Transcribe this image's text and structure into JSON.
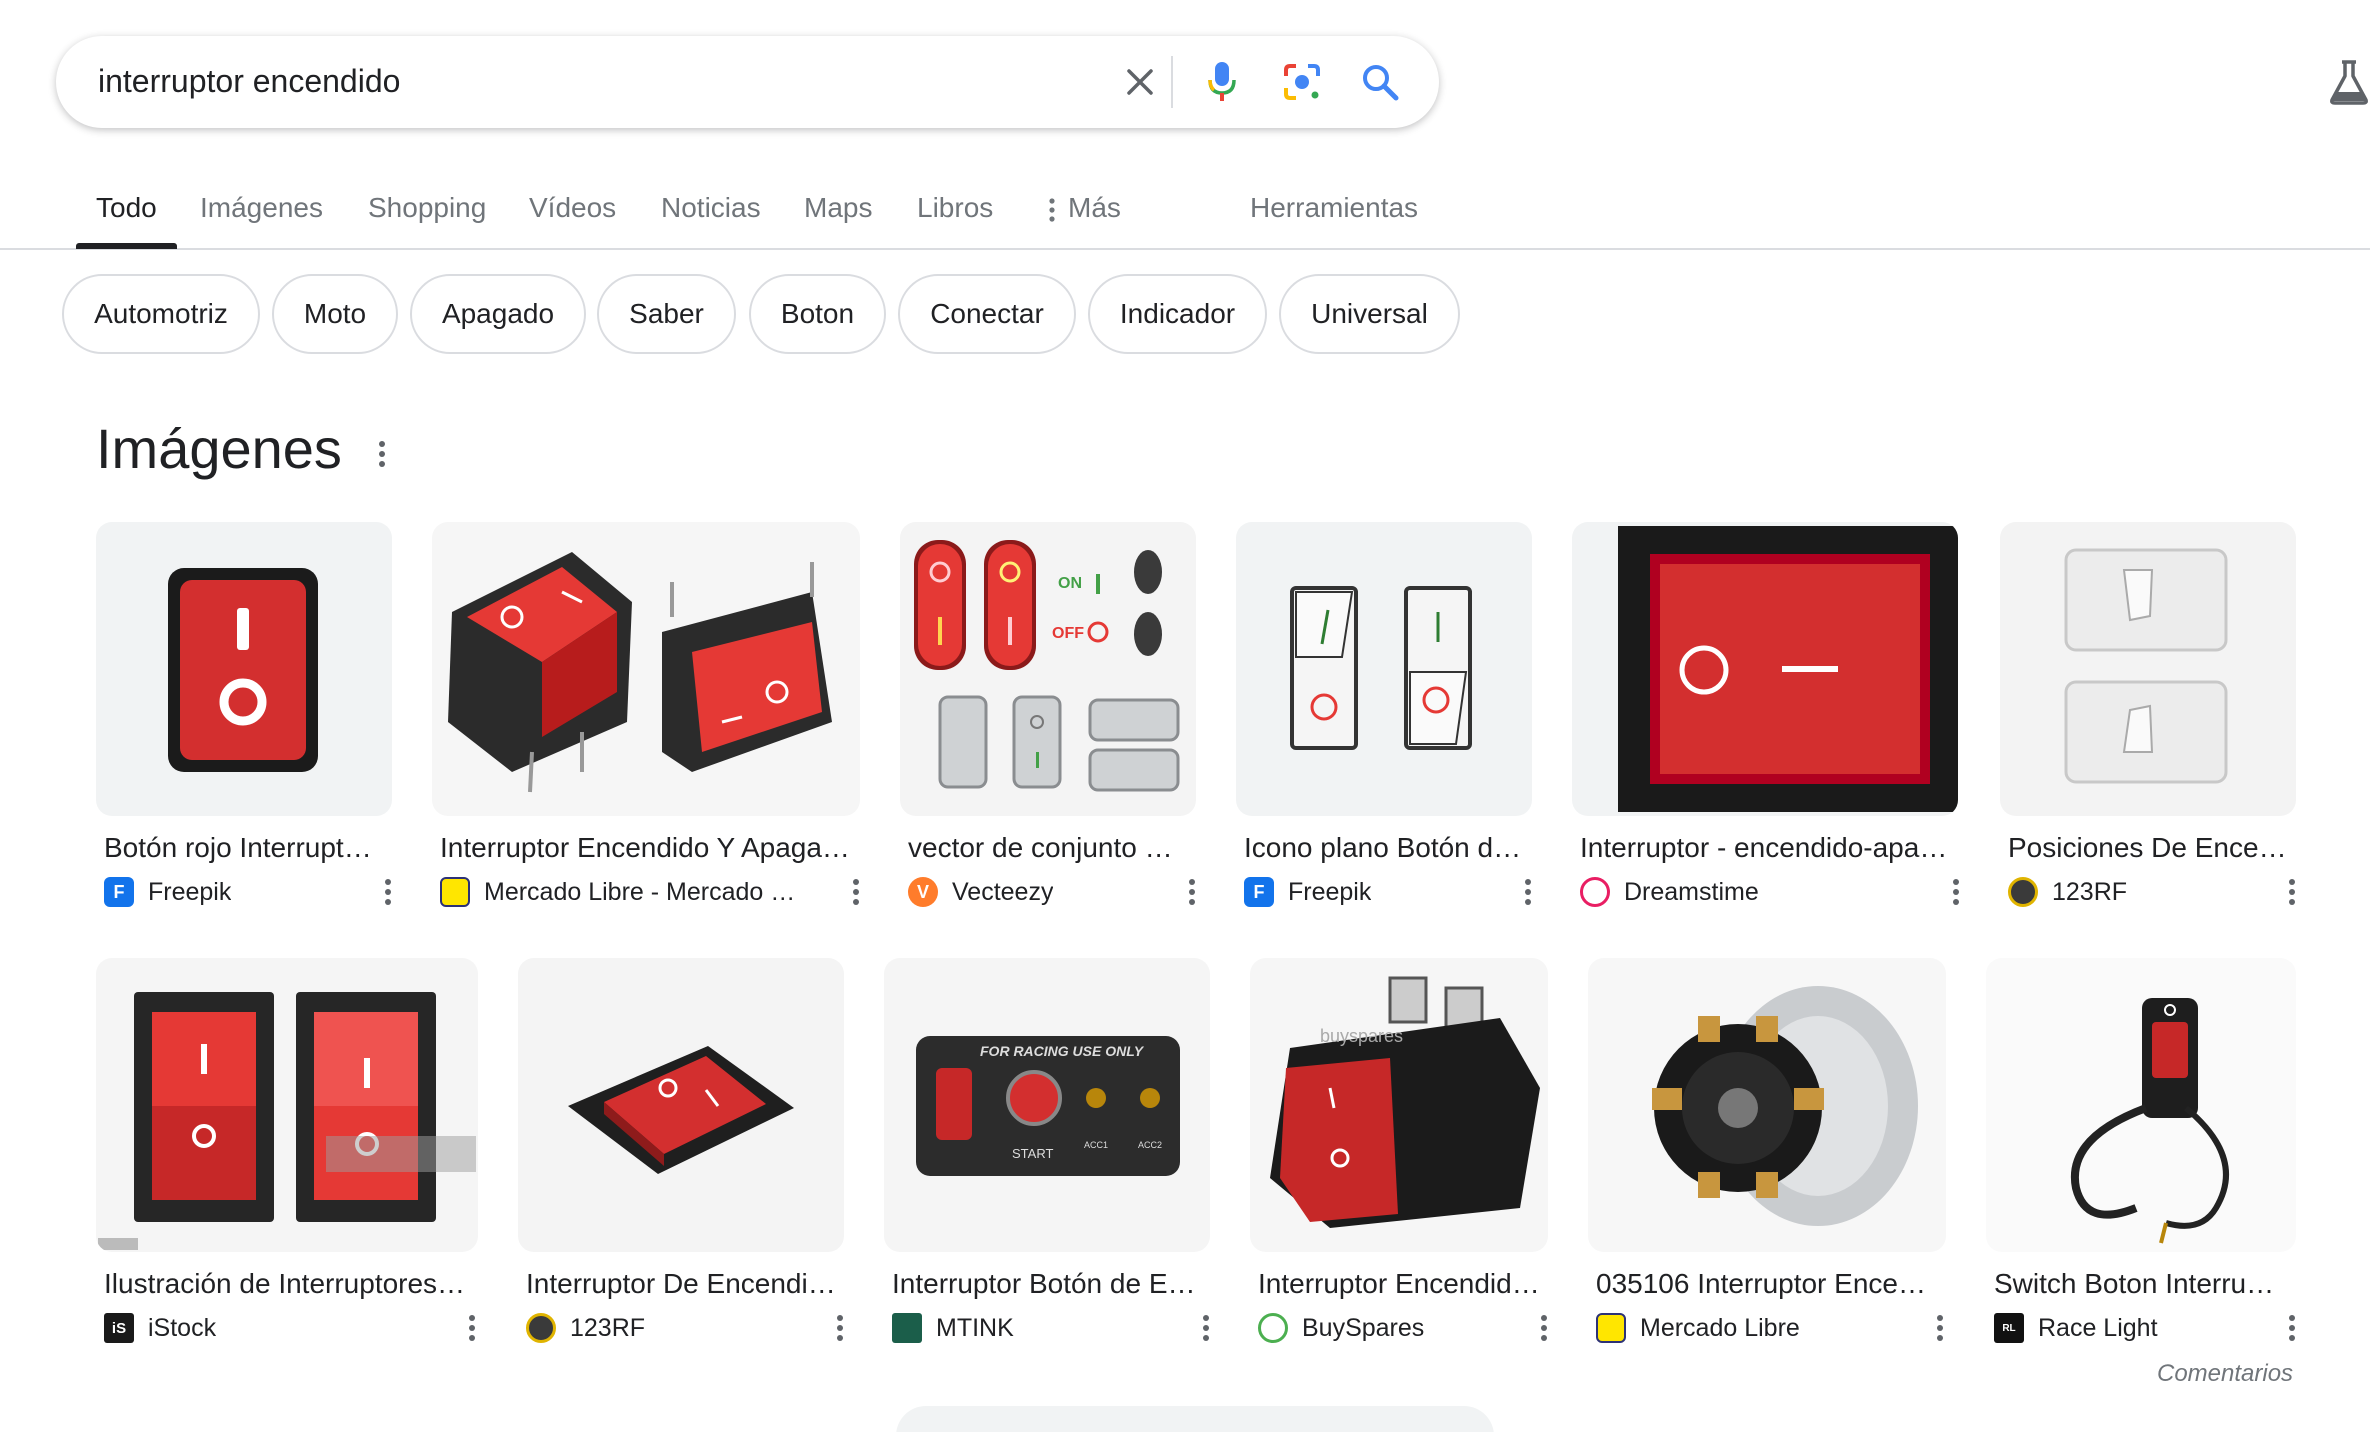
{
  "search": {
    "query": "interruptor encendido"
  },
  "tabs": [
    "Todo",
    "Imágenes",
    "Shopping",
    "Vídeos",
    "Noticias",
    "Maps",
    "Libros",
    "Más",
    "Herramientas"
  ],
  "chips": [
    "Automotriz",
    "Moto",
    "Apagado",
    "Saber",
    "Boton",
    "Conectar",
    "Indicador",
    "Universal"
  ],
  "images_section": {
    "title": "Imágenes",
    "row1": [
      {
        "caption": "Botón rojo Interrupt…",
        "source": "Freepik"
      },
      {
        "caption": "Interruptor Encendido Y Apaga…",
        "source": "Mercado Libre - Mercado Li…"
      },
      {
        "caption": "vector de conjunto …",
        "source": "Vecteezy"
      },
      {
        "caption": "Icono plano Botón d…",
        "source": "Freepik"
      },
      {
        "caption": "Interruptor - encendido-apa…",
        "source": "Dreamstime"
      },
      {
        "caption": "Posiciones De Ence…",
        "source": "123RF"
      }
    ],
    "row2": [
      {
        "caption": "Ilustración de Interruptores…",
        "source": "iStock"
      },
      {
        "caption": "Interruptor De Encendi…",
        "source": "123RF"
      },
      {
        "caption": "Interruptor Botón de E…",
        "source": "MTINK"
      },
      {
        "caption": "Interruptor Encendid…",
        "source": "BuySpares"
      },
      {
        "caption": "035106 Interruptor Ence…",
        "source": "Mercado Libre"
      },
      {
        "caption": "Switch Boton Interru…",
        "source": "Race Light"
      }
    ]
  },
  "footer": {
    "feedback": "Comentarios"
  },
  "colors": {
    "google_blue": "#4285f4",
    "google_red": "#ea4335",
    "google_yellow": "#fbbc04",
    "google_green": "#34a853",
    "switch_red": "#d32f2f"
  }
}
